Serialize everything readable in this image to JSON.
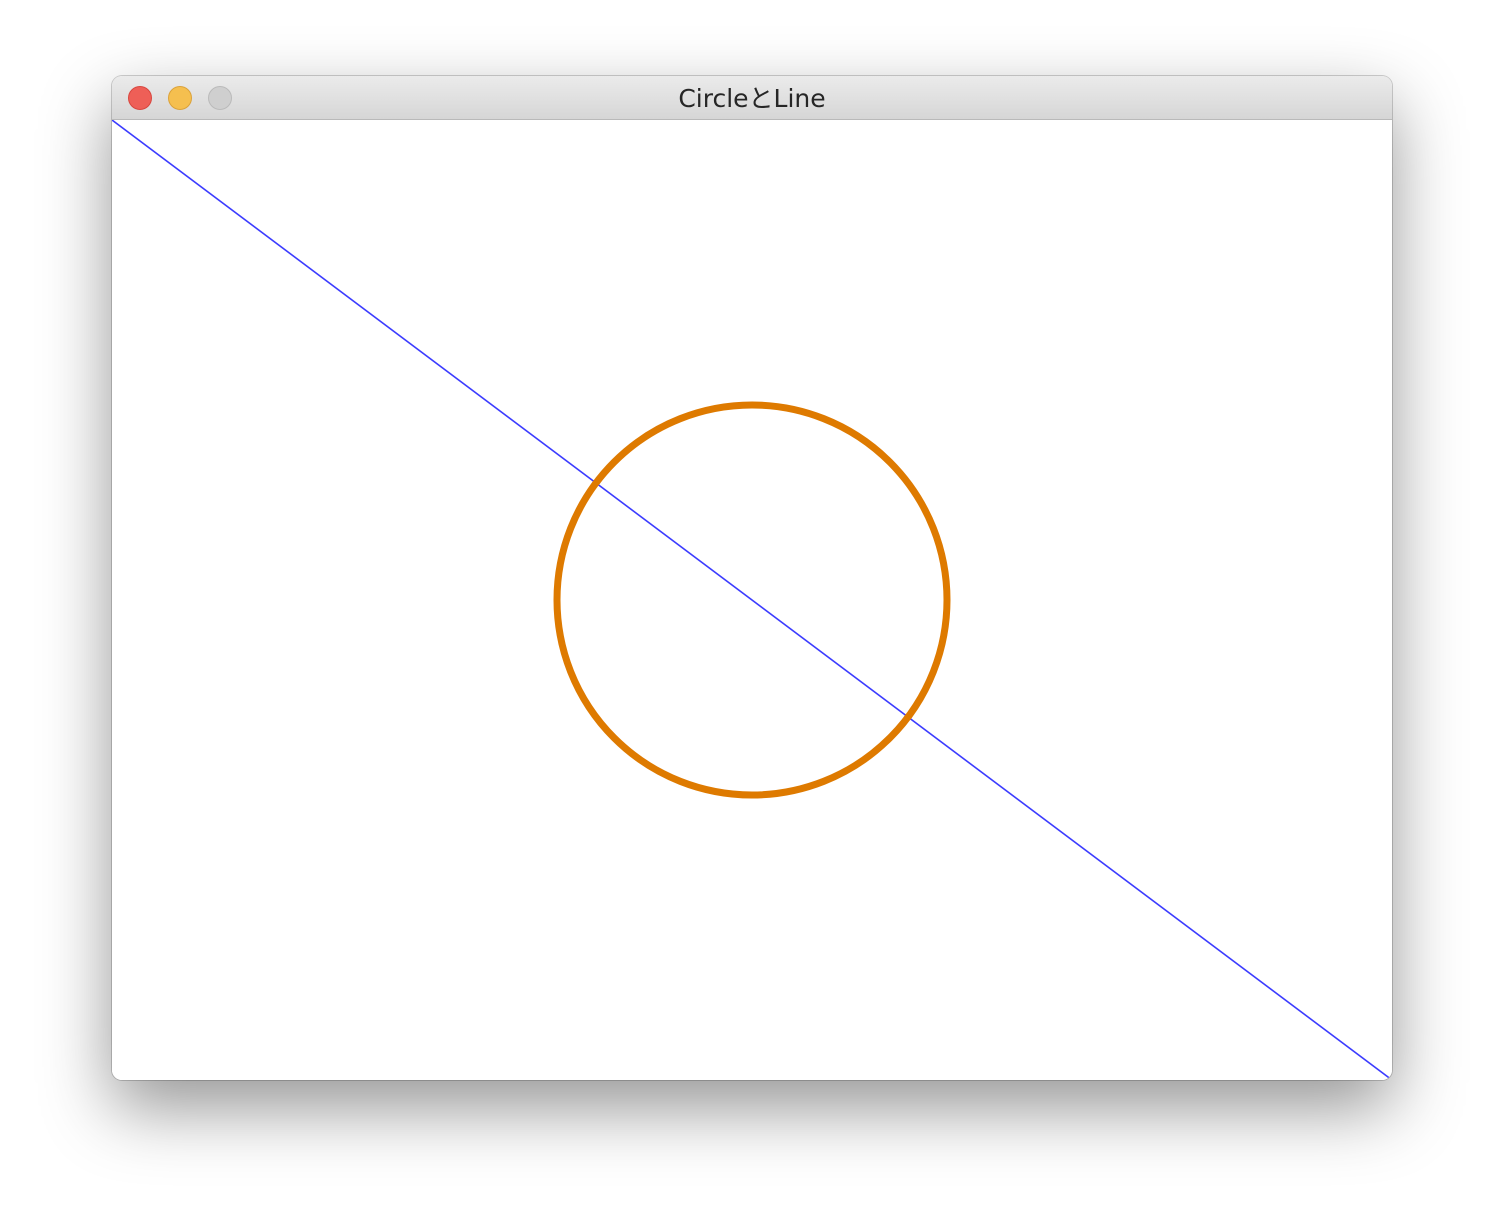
{
  "window": {
    "title": "CircleとLine",
    "controls": [
      "close",
      "minimize",
      "zoom"
    ],
    "control_colors": {
      "close": "#ee5f57",
      "minimize": "#f5bf4f",
      "zoom": "#cfcfcf"
    }
  },
  "scene": {
    "background": "#ffffff",
    "line": {
      "color": "#3b3bff",
      "from": "top-left",
      "to": "bottom-right"
    },
    "circle": {
      "color": "#de7a00",
      "fill": "none",
      "center": "canvas-center"
    }
  }
}
